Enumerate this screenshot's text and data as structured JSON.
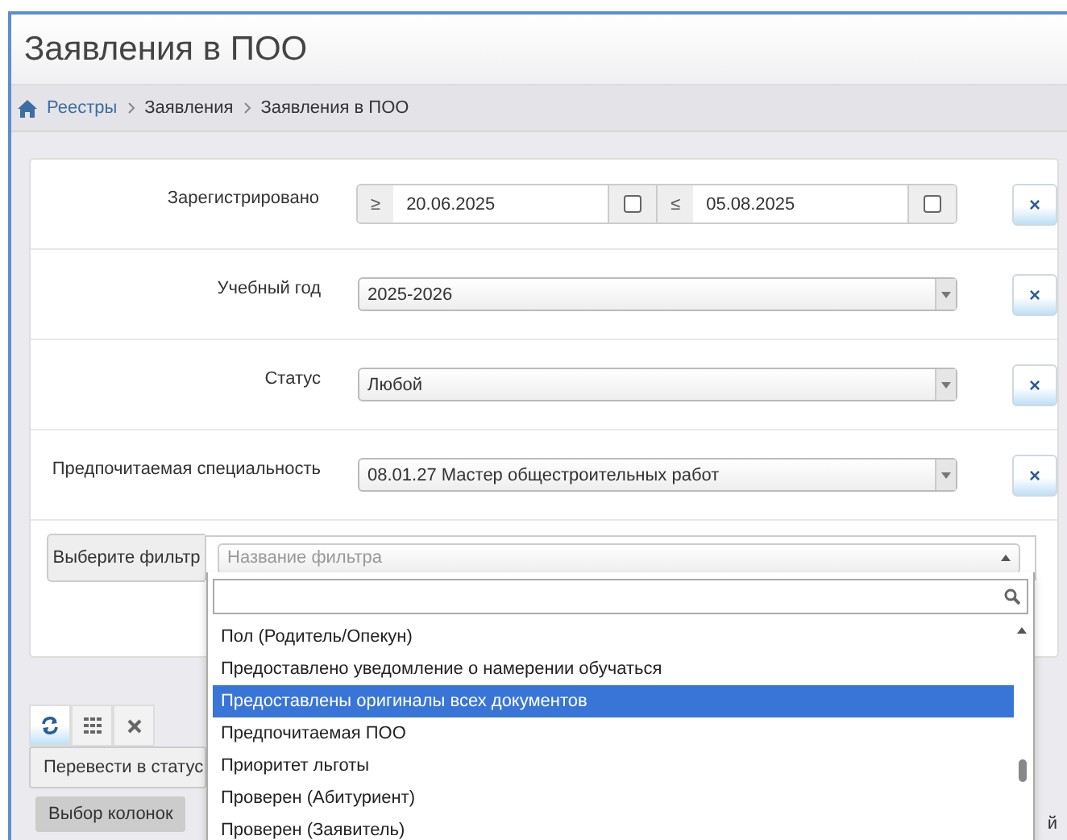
{
  "page_title": "Заявления в ПОО",
  "breadcrumbs": [
    {
      "label": "Реестры",
      "link": true
    },
    {
      "label": "Заявления",
      "link": false
    },
    {
      "label": "Заявления в ПОО",
      "link": false
    }
  ],
  "filters": [
    {
      "kind": "daterange",
      "label": "Зарегистрировано",
      "from_sign": "≥",
      "from": "20.06.2025",
      "from_checked": false,
      "to_sign": "≤",
      "to": "05.08.2025",
      "to_checked": false,
      "clear": "×"
    },
    {
      "kind": "select",
      "label": "Учебный год",
      "value": "2025-2026",
      "clear": "×"
    },
    {
      "kind": "select",
      "label": "Статус",
      "value": "Любой",
      "clear": "×"
    },
    {
      "kind": "select",
      "label": "Предпочитаемая специальность",
      "value": "08.01.27 Мастер общестроительных работ",
      "clear": "×"
    }
  ],
  "filter_picker": {
    "label": "Выберите фильтр",
    "placeholder": "Название фильтра",
    "expanded": true,
    "options": [
      {
        "label": "Пол (Родитель/Опекун)",
        "selected": false
      },
      {
        "label": "Предоставлено уведомление о намерении обучаться",
        "selected": false
      },
      {
        "label": "Предоставлены оригиналы всех документов",
        "selected": true
      },
      {
        "label": "Предпочитаемая ПОО",
        "selected": false
      },
      {
        "label": "Приоритет льготы",
        "selected": false
      },
      {
        "label": "Проверен (Абитуриент)",
        "selected": false
      },
      {
        "label": "Проверен (Заявитель)",
        "selected": false
      }
    ]
  },
  "toolbar": [
    {
      "kind": "refresh",
      "selected": true
    },
    {
      "kind": "grid",
      "selected": false
    },
    {
      "kind": "clear",
      "selected": false
    }
  ],
  "status_button": "Перевести в статус",
  "columns_button": "Выбор колонок",
  "partial_label": "й"
}
